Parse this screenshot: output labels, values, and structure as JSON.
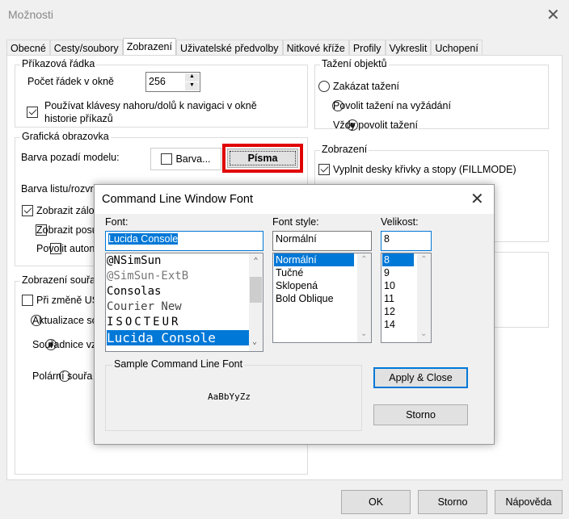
{
  "window": {
    "title": "Možnosti",
    "close_icon": "close-icon"
  },
  "tabs": [
    "Obecné",
    "Cesty/soubory",
    "Zobrazení",
    "Uživatelské předvolby",
    "Nitkové kříže",
    "Profily",
    "Vykreslit",
    "Uchopení"
  ],
  "active_tab": "Zobrazení",
  "command_line": {
    "label": "Příkazová řádka",
    "lines_label": "Počet řádek v okně",
    "lines_value": "256",
    "arrow_keys_label": "Používat klávesy nahoru/dolů k navigaci v okně historie příkazů",
    "arrow_keys_checked": true
  },
  "graphics": {
    "label": "Grafická obrazovka",
    "bg_label": "Barva pozadí modelu:",
    "color_button": "Barva...",
    "fonts_button": "Písma",
    "layout_label": "Barva listu/rozvr",
    "show_label": "Zobrazit zálo",
    "show_checked": true,
    "show_pos_label": "Zobrazit posu",
    "auto_label": "Povolit auton"
  },
  "coords": {
    "label": "Zobrazení souřa",
    "ucs_label": "Při změně US",
    "update_label": "Aktualizace so",
    "relative_label": "Souřadnice vz",
    "polar_label": "Polární souřa",
    "selected": "relative"
  },
  "drag": {
    "label": "Tažení objektů",
    "options": [
      "Zakázat tažení",
      "Povolit tažení na vyžádání",
      "Vždy povolit tažení"
    ],
    "selected": 2
  },
  "display": {
    "label": "Zobrazení",
    "fillmode_label": "Vyplnit desky křivky a stopy (FILLMODE)",
    "fillmode_checked": true
  },
  "footer": {
    "ok": "OK",
    "cancel": "Storno",
    "help": "Nápověda"
  },
  "highlight_color": "#e00000",
  "font_dialog": {
    "title": "Command Line Window Font",
    "font_label": "Font:",
    "font_value": "Lucida Console",
    "fonts": [
      "@NSimSun",
      "@SimSun-ExtB",
      "Consolas",
      "Courier New",
      "ISOCTEUR",
      "Lucida Console"
    ],
    "selected_font": "Lucida Console",
    "style_label": "Font style:",
    "style_value": "Normální",
    "styles": [
      "Normální",
      "Tučné",
      "Sklopená",
      "Bold Oblique"
    ],
    "size_label": "Velikost:",
    "size_value": "8",
    "sizes": [
      "8",
      "9",
      "10",
      "11",
      "12",
      "14"
    ],
    "sample_label": "Sample Command Line Font",
    "sample_text": "AaBbYyZz",
    "apply_button": "Apply & Close",
    "cancel_button": "Storno"
  }
}
